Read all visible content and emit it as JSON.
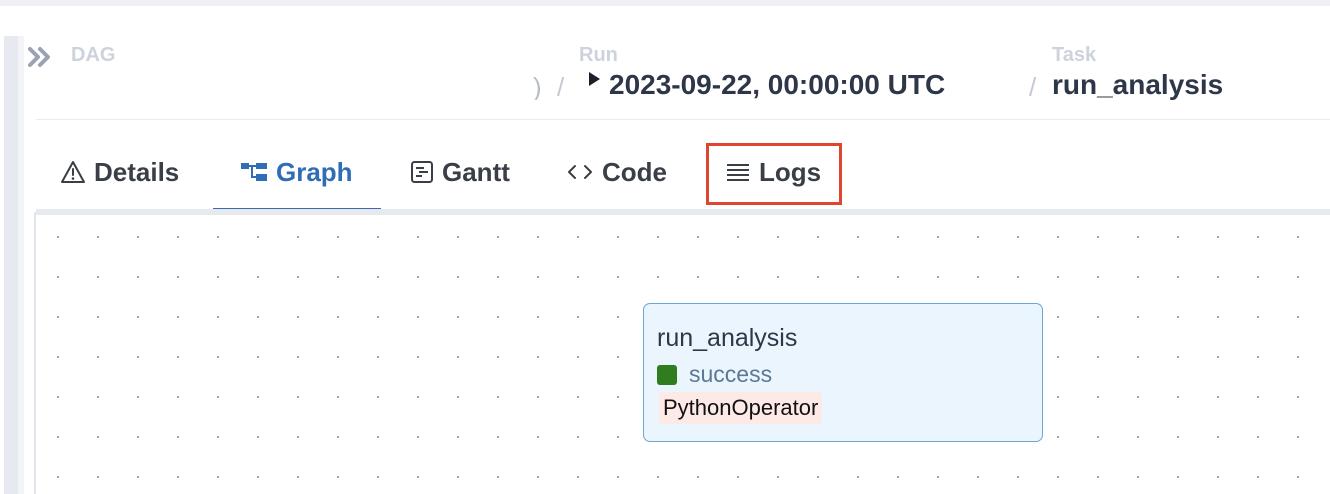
{
  "breadcrumb": {
    "dag_label": "DAG",
    "dag_value_fragment": ")",
    "separator": "/",
    "run_label": "Run",
    "run_value": "2023-09-22, 00:00:00 UTC",
    "task_label": "Task",
    "task_value": "run_analysis"
  },
  "tabs": [
    {
      "label": "Details",
      "icon": "warning-triangle-icon",
      "active": false
    },
    {
      "label": "Graph",
      "icon": "graph-icon",
      "active": true
    },
    {
      "label": "Gantt",
      "icon": "gantt-icon",
      "active": false
    },
    {
      "label": "Code",
      "icon": "code-icon",
      "active": false
    },
    {
      "label": "Logs",
      "icon": "logs-icon",
      "active": false,
      "highlighted": true
    }
  ],
  "graph": {
    "node": {
      "task_id": "run_analysis",
      "status": "success",
      "status_color": "#2f7d1f",
      "operator": "PythonOperator"
    }
  },
  "colors": {
    "accent": "#3c6bb0",
    "highlight_border": "#e0452f",
    "node_background": "#eaf5fd",
    "node_border": "#6aa6d6"
  }
}
